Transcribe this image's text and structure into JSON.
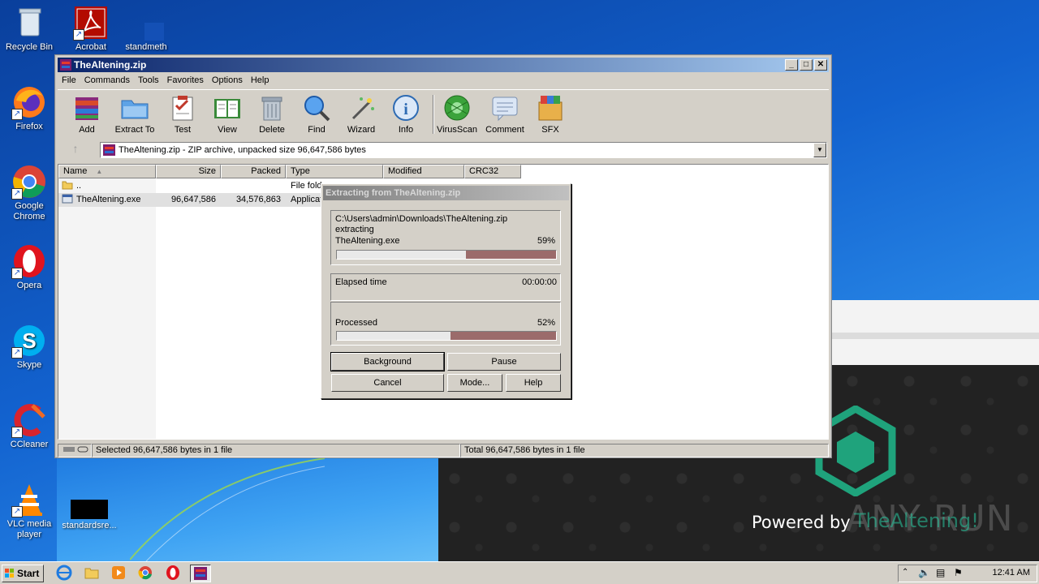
{
  "desktop": {
    "icons": [
      {
        "name": "recycle-bin",
        "label": "Recycle Bin"
      },
      {
        "name": "acrobat",
        "label": "Acrobat"
      },
      {
        "name": "standmeth",
        "label": "standmeth"
      },
      {
        "name": "firefox",
        "label": "Firefox"
      },
      {
        "name": "google-chrome",
        "label": "Google Chrome"
      },
      {
        "name": "opera",
        "label": "Opera"
      },
      {
        "name": "skype",
        "label": "Skype"
      },
      {
        "name": "ccleaner",
        "label": "CCleaner"
      },
      {
        "name": "vlc",
        "label": "VLC media player"
      },
      {
        "name": "standardsre",
        "label": "standardsre..."
      }
    ],
    "branding": {
      "powered_by": "Powered by",
      "anyrun": "ANY RUN",
      "watermark": "TheAltening!"
    }
  },
  "winrar": {
    "title": "TheAltening.zip",
    "menu": [
      "File",
      "Commands",
      "Tools",
      "Favorites",
      "Options",
      "Help"
    ],
    "toolbar": [
      "Add",
      "Extract To",
      "Test",
      "View",
      "Delete",
      "Find",
      "Wizard",
      "Info",
      "VirusScan",
      "Comment",
      "SFX"
    ],
    "address": "TheAltening.zip - ZIP archive, unpacked size 96,647,586 bytes",
    "columns": [
      "Name",
      "Size",
      "Packed",
      "Type",
      "Modified",
      "CRC32"
    ],
    "rows": [
      {
        "name": "..",
        "size": "",
        "packed": "",
        "type": "File fold",
        "modified": "",
        "crc": ""
      },
      {
        "name": "TheAltening.exe",
        "size": "96,647,586",
        "packed": "34,576,863",
        "type": "Applicati",
        "modified": "",
        "crc": ""
      }
    ],
    "status_left": "Selected 96,647,586 bytes in 1 file",
    "status_right": "Total 96,647,586 bytes in 1 file"
  },
  "extract_dialog": {
    "title": "Extracting from TheAltening.zip",
    "path": "C:\\Users\\admin\\Downloads\\TheAltening.zip",
    "action": "extracting",
    "file": "TheAltening.exe",
    "file_percent_label": "59%",
    "file_progress": 0.59,
    "elapsed_label": "Elapsed time",
    "elapsed_value": "00:00:00",
    "processed_label": "Processed",
    "processed_percent_label": "52%",
    "processed_progress": 0.52,
    "buttons": {
      "background": "Background",
      "pause": "Pause",
      "cancel": "Cancel",
      "mode": "Mode...",
      "help": "Help"
    }
  },
  "taskbar": {
    "start": "Start",
    "clock": "12:41 AM"
  }
}
